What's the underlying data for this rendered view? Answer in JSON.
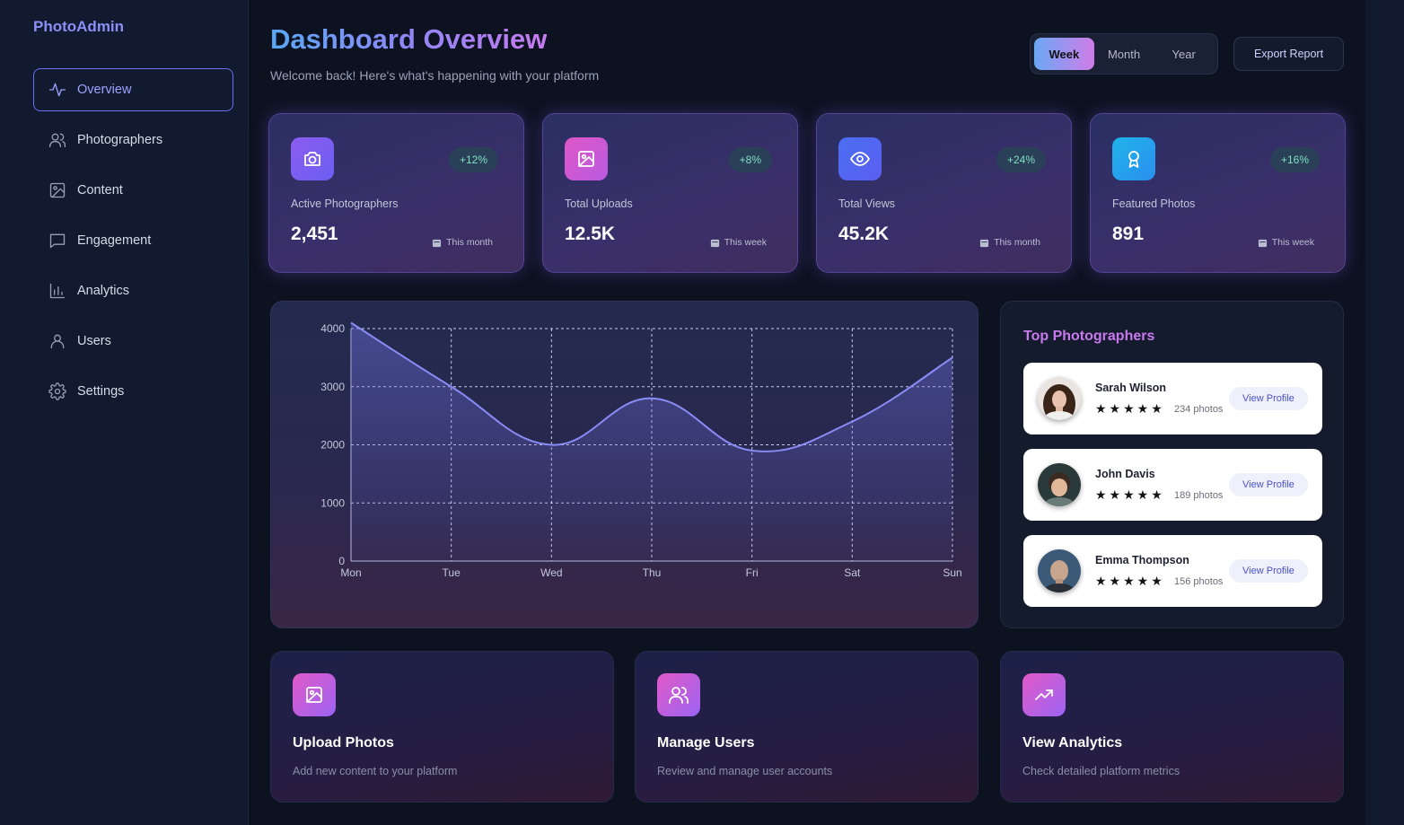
{
  "sidebar": {
    "brand": "PhotoAdmin",
    "items": [
      {
        "label": "Overview",
        "icon": "activity-icon"
      },
      {
        "label": "Photographers",
        "icon": "users-icon"
      },
      {
        "label": "Content",
        "icon": "image-icon"
      },
      {
        "label": "Engagement",
        "icon": "message-icon"
      },
      {
        "label": "Analytics",
        "icon": "bar-chart-icon"
      },
      {
        "label": "Users",
        "icon": "user-icon"
      },
      {
        "label": "Settings",
        "icon": "gear-icon"
      }
    ]
  },
  "header": {
    "title": "Dashboard Overview",
    "subtitle": "Welcome back! Here's what's happening with your platform",
    "periods": [
      "Week",
      "Month",
      "Year"
    ],
    "active_period": "Week",
    "export_label": "Export Report"
  },
  "stats": [
    {
      "label": "Active Photographers",
      "value": "2,451",
      "change": "+12%",
      "period": "This month",
      "icon": "camera-icon",
      "color": "#7c5cf0"
    },
    {
      "label": "Total Uploads",
      "value": "12.5K",
      "change": "+8%",
      "period": "This week",
      "icon": "image-icon",
      "color": "#d158d4"
    },
    {
      "label": "Total Views",
      "value": "45.2K",
      "change": "+24%",
      "period": "This month",
      "icon": "eye-icon",
      "color": "#4b6ff2"
    },
    {
      "label": "Featured Photos",
      "value": "891",
      "change": "+16%",
      "period": "This week",
      "icon": "award-icon",
      "color": "#1fa5e8"
    }
  ],
  "chart_data": {
    "type": "area",
    "categories": [
      "Mon",
      "Tue",
      "Wed",
      "Thu",
      "Fri",
      "Sat",
      "Sun"
    ],
    "values": [
      4100,
      3000,
      2000,
      2800,
      1900,
      2400,
      3500
    ],
    "ylim": [
      0,
      4000
    ],
    "yticks": [
      0,
      1000,
      2000,
      3000,
      4000
    ],
    "grid": true,
    "line_color": "#8a8cf5"
  },
  "top_photographers": {
    "title": "Top Photographers",
    "button_label": "View Profile",
    "items": [
      {
        "name": "Sarah Wilson",
        "stars": "★★★★★",
        "count": "234 photos"
      },
      {
        "name": "John Davis",
        "stars": "★★★★★",
        "count": "189 photos"
      },
      {
        "name": "Emma Thompson",
        "stars": "★★★★★",
        "count": "156 photos"
      }
    ]
  },
  "actions": [
    {
      "title": "Upload Photos",
      "desc": "Add new content to your platform",
      "icon": "image-icon"
    },
    {
      "title": "Manage Users",
      "desc": "Review and manage user accounts",
      "icon": "users-icon"
    },
    {
      "title": "View Analytics",
      "desc": "Check detailed platform metrics",
      "icon": "trending-up-icon"
    }
  ]
}
